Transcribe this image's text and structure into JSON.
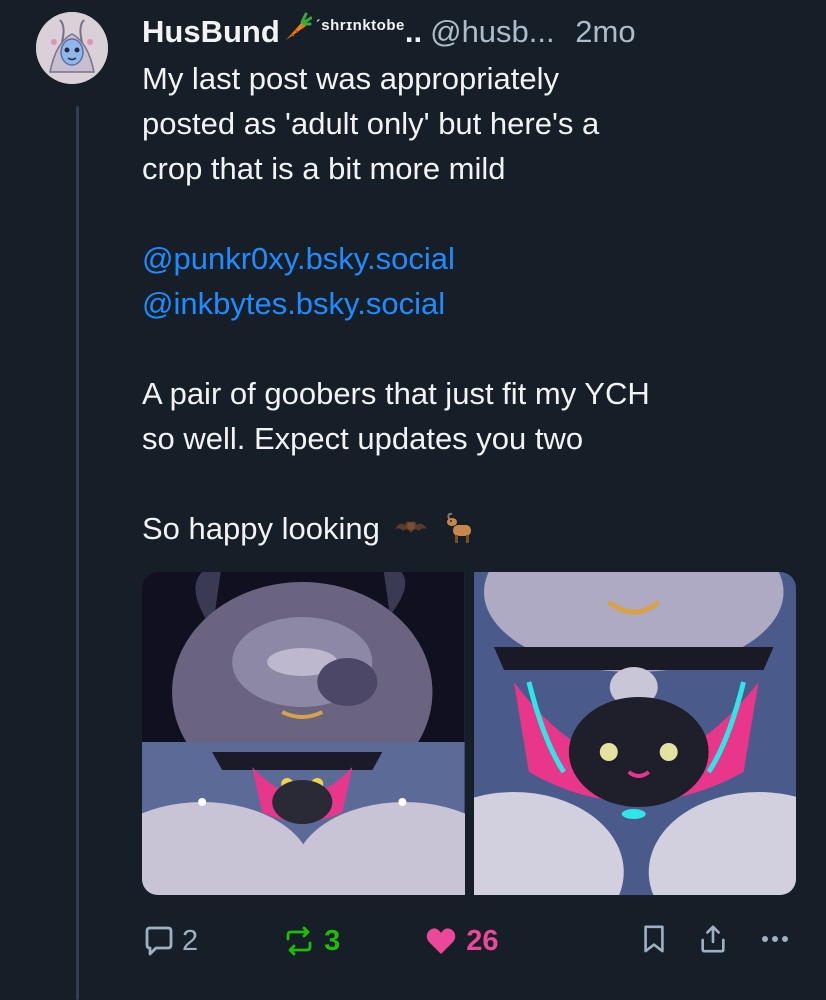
{
  "author": {
    "display_name": "HusBund",
    "name_extra": "ˊshrɪnktobe",
    "ellipsis": "..",
    "handle": "@husb...",
    "time": "2mo",
    "avatar_icon": "avatar-image",
    "carrot_icon": "carrot-emoji"
  },
  "post": {
    "lines": [
      "My last post was appropriately",
      "posted as 'adult only' but here's a",
      "crop that is a bit more mild"
    ],
    "mentions": [
      "@punkr0xy.bsky.social",
      "@inkbytes.bsky.social"
    ],
    "lines2": [
      "A pair of goobers that just fit my YCH",
      "so well. Expect updates you two"
    ],
    "closing": "So happy looking",
    "closing_emojis": [
      "bat-emoji",
      "goat-emoji"
    ]
  },
  "media": {
    "images": [
      "post-image-1",
      "post-image-2"
    ]
  },
  "actions": {
    "reply_count": "2",
    "repost_count": "3",
    "like_count": "26",
    "colors": {
      "muted": "#9fb0c2",
      "repost": "#20bc07",
      "like": "#ec4899",
      "link": "#208bfe"
    }
  }
}
